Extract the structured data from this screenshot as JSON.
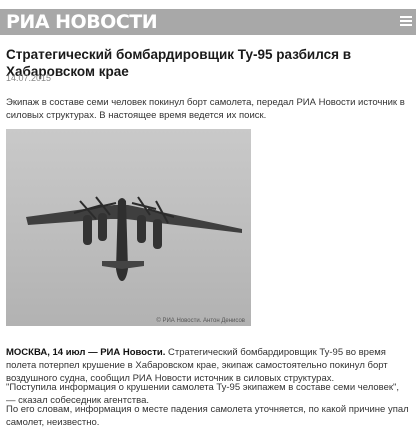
{
  "header": {
    "logo": "РИА НОВОСТИ",
    "menu_icon": "menu-icon"
  },
  "article": {
    "title": "Стратегический бомбардировщик Ту-95 разбился в Хабаровском крае",
    "date": "14.07.2015",
    "lead": "Экипаж в составе семи человек покинул борт самолета, передал РИА Новости источник в силовых структурах. В настоящее время ведется их поиск.",
    "photo_caption": "© РИА Новости. Антон Денисов",
    "p1_dateline": "МОСКВА, 14 июл — РИА Новости.",
    "p1_text": " Стратегический бомбардировщик Ту-95 во время полета потерпел крушение в Хабаровском крае, экипаж самостоятельно покинул борт воздушного судна, сообщил РИА Новости источник в силовых структурах.",
    "p2": "\"Поступила информация о крушении самолета Ту-95 экипажем в составе семи человек\", — сказал собеседник агентства.",
    "p3": "По его словам, информация о месте падения самолета уточняется, по какой причине упал самолет, неизвестно."
  }
}
